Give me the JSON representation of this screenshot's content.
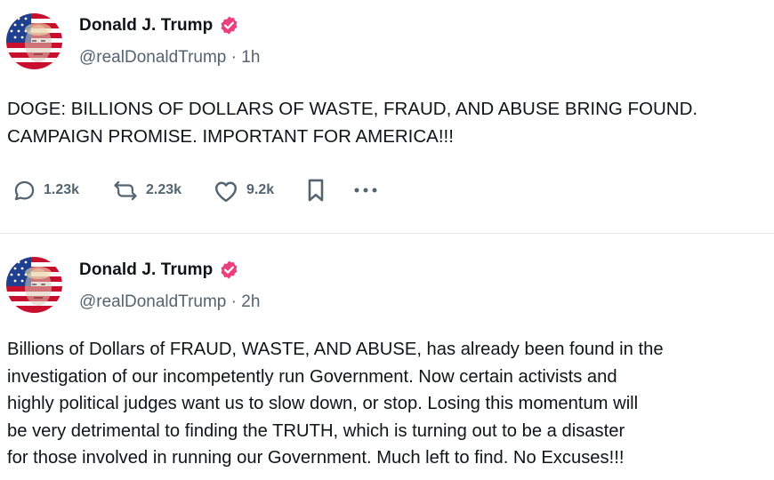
{
  "posts": [
    {
      "author": "Donald J. Trump",
      "handle": "@realDonaldTrump",
      "time": "1h",
      "text_lines": [
        "DOGE: BILLIONS OF DOLLARS OF WASTE, FRAUD, AND ABUSE BRING FOUND.",
        "CAMPAIGN PROMISE. IMPORTANT FOR AMERICA!!!"
      ],
      "replies": "1.23k",
      "retruths": "2.23k",
      "likes": "9.2k"
    },
    {
      "author": "Donald J. Trump",
      "handle": "@realDonaldTrump",
      "time": "2h",
      "text_lines": [
        "Billions of Dollars of FRAUD, WASTE, AND ABUSE, has already been found in the",
        "investigation of our incompetently run Government. Now certain activists and",
        "highly political judges want us to slow down, or stop. Losing this momentum will",
        "be very detrimental to finding the TRUTH, which is turning out to be a disaster",
        "for those involved in running our Government. Much left to find. No Excuses!!!"
      ]
    }
  ],
  "separator": " · ",
  "icons": {
    "verified": "verified-badge-icon",
    "reply": "reply-icon",
    "retruth": "retruth-icon",
    "like": "heart-icon",
    "bookmark": "bookmark-icon",
    "more": "more-dots-icon"
  },
  "colors": {
    "verified": "#ec407a",
    "muted": "#536471",
    "text": "#0f1419"
  }
}
